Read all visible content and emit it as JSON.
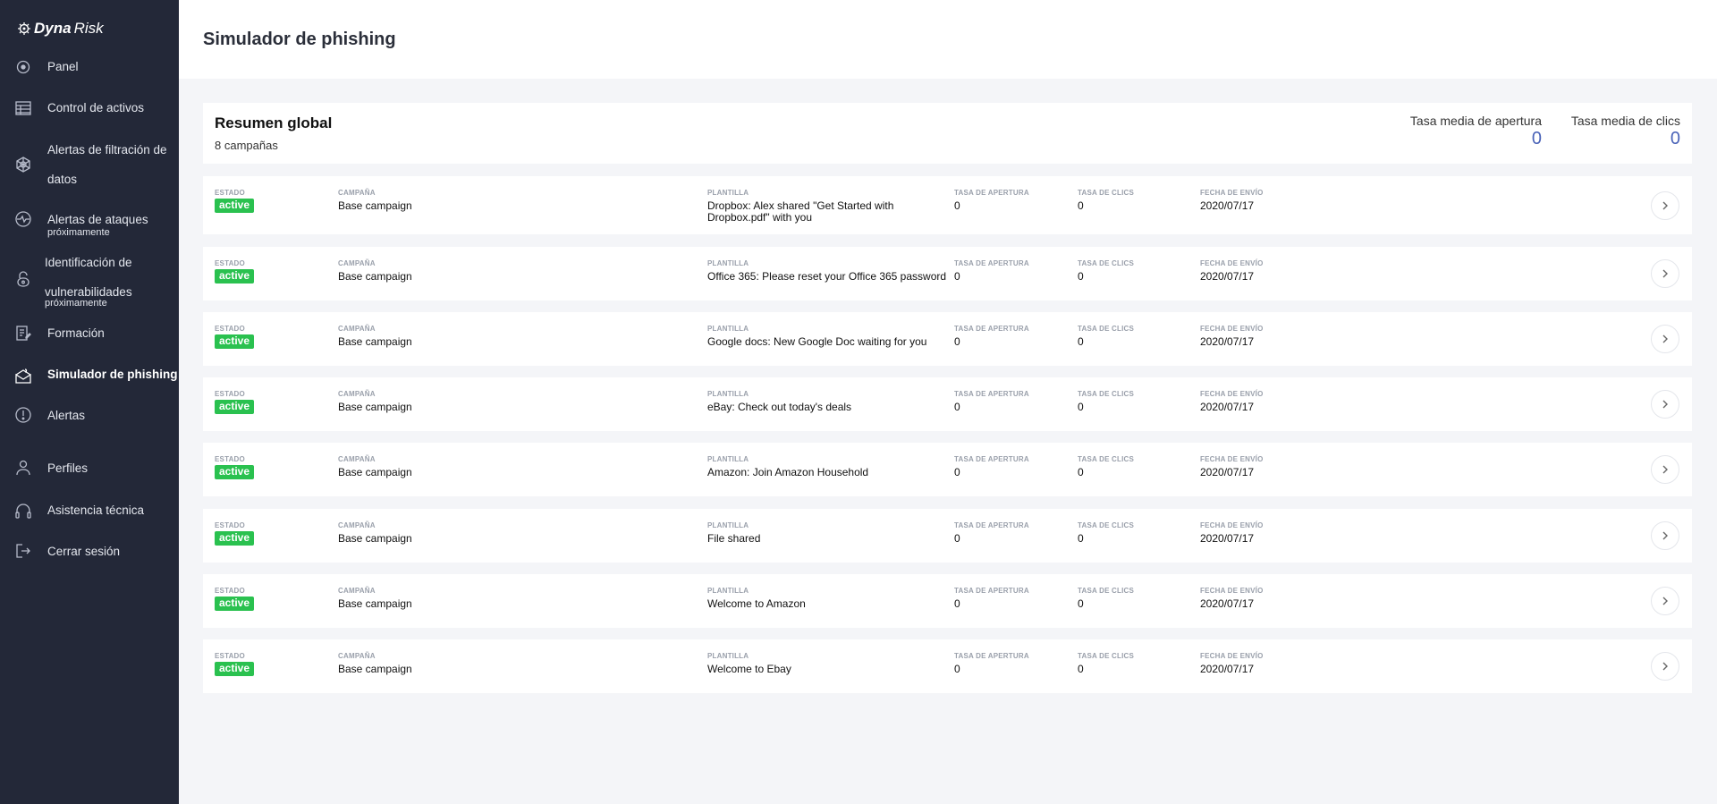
{
  "brand": {
    "bold": "Dyna",
    "light": "Risk"
  },
  "sidebar": {
    "items": [
      {
        "label": "Panel",
        "sub": ""
      },
      {
        "label": "Control de activos",
        "sub": ""
      },
      {
        "label": "Alertas de filtración de",
        "label2": "datos",
        "sub": ""
      },
      {
        "label": "Alertas de ataques",
        "sub": "próximamente"
      },
      {
        "label": "Identificación de",
        "label2": "vulnerabilidades",
        "sub": "próximamente"
      },
      {
        "label": "Formación",
        "sub": ""
      },
      {
        "label": "Simulador de phishing",
        "sub": ""
      },
      {
        "label": "Alertas",
        "sub": ""
      },
      {
        "label": "Perfiles",
        "sub": ""
      },
      {
        "label": "Asistencia técnica",
        "sub": ""
      },
      {
        "label": "Cerrar sesión",
        "sub": ""
      }
    ]
  },
  "header": {
    "title": "Simulador de phishing"
  },
  "summary": {
    "title": "Resumen global",
    "count": "8 campañas",
    "open_rate_label": "Tasa media de apertura",
    "open_rate_value": "0",
    "click_rate_label": "Tasa media de clics",
    "click_rate_value": "0"
  },
  "columns": {
    "status": "Estado",
    "campaign": "Campaña",
    "template": "Plantilla",
    "open_rate": "Tasa de apertura",
    "click_rate": "Tasa de clics",
    "send_date": "Fecha de envío"
  },
  "campaigns": [
    {
      "status": "active",
      "name": "Base campaign",
      "template": "Dropbox: Alex shared \"Get Started with",
      "template2": "Dropbox.pdf\" with you",
      "open_rate": "0",
      "click_rate": "0",
      "date": "2020/07/17"
    },
    {
      "status": "active",
      "name": "Base campaign",
      "template": "Office 365: Please reset your Office 365 password",
      "template2": "",
      "open_rate": "0",
      "click_rate": "0",
      "date": "2020/07/17"
    },
    {
      "status": "active",
      "name": "Base campaign",
      "template": "Google docs: New Google Doc waiting for you",
      "template2": "",
      "open_rate": "0",
      "click_rate": "0",
      "date": "2020/07/17"
    },
    {
      "status": "active",
      "name": "Base campaign",
      "template": "eBay: Check out today's deals",
      "template2": "",
      "open_rate": "0",
      "click_rate": "0",
      "date": "2020/07/17"
    },
    {
      "status": "active",
      "name": "Base campaign",
      "template": "Amazon: Join Amazon Household",
      "template2": "",
      "open_rate": "0",
      "click_rate": "0",
      "date": "2020/07/17"
    },
    {
      "status": "active",
      "name": "Base campaign",
      "template": "File shared",
      "template2": "",
      "open_rate": "0",
      "click_rate": "0",
      "date": "2020/07/17"
    },
    {
      "status": "active",
      "name": "Base campaign",
      "template": "Welcome to Amazon",
      "template2": "",
      "open_rate": "0",
      "click_rate": "0",
      "date": "2020/07/17"
    },
    {
      "status": "active",
      "name": "Base campaign",
      "template": "Welcome to Ebay",
      "template2": "",
      "open_rate": "0",
      "click_rate": "0",
      "date": "2020/07/17"
    }
  ],
  "colors": {
    "sidebar_bg": "#232838",
    "active_badge": "#2ac14f",
    "metric_value": "#4a63b8"
  },
  "icons": [
    "dashboard-icon",
    "assets-icon",
    "web-icon",
    "pulse-icon",
    "lock-icon",
    "training-icon",
    "phishing-icon",
    "alert-icon",
    "user-icon",
    "headset-icon",
    "logout-icon",
    "chevron-right-icon"
  ]
}
